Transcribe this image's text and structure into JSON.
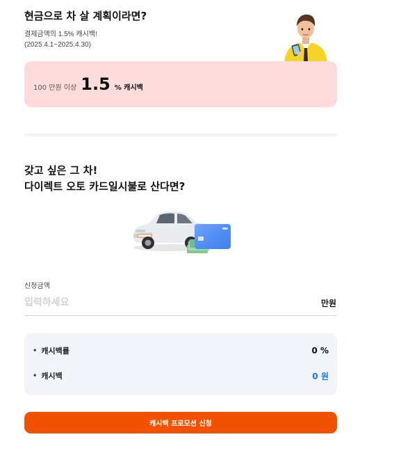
{
  "promo": {
    "title": "현금으로 차 살 계획이라면?",
    "subtitle_line1": "결제금액의 1.5% 캐시백!",
    "subtitle_line2": "(2025.4.1~2025.4.30)",
    "rate_prefix": "100 만원 이상",
    "rate_value": "1.5",
    "rate_suffix": "% 캐시백"
  },
  "card_section": {
    "title_line1": "갖고 싶은 그 차!",
    "title_line2": "다이렉트 오토 카드일시불로 산다면?"
  },
  "form": {
    "label": "신청금액",
    "placeholder": "입력하세요",
    "unit": "만원"
  },
  "result": {
    "rate_label": "캐시백률",
    "rate_value": "0 %",
    "cashback_label": "캐시백",
    "cashback_value": "0 원"
  },
  "cta": {
    "label": "캐시백 프로모션 신청"
  },
  "colors": {
    "promo_bg": "#ffdcdc",
    "cta_bg": "#f25100",
    "result_bg": "#f3f4f9",
    "value_blue": "#1a7bf0"
  },
  "icons": {
    "character": "person-with-tablet-illustration",
    "car": "car-with-card-illustration",
    "bullet": "bullet-dot"
  }
}
